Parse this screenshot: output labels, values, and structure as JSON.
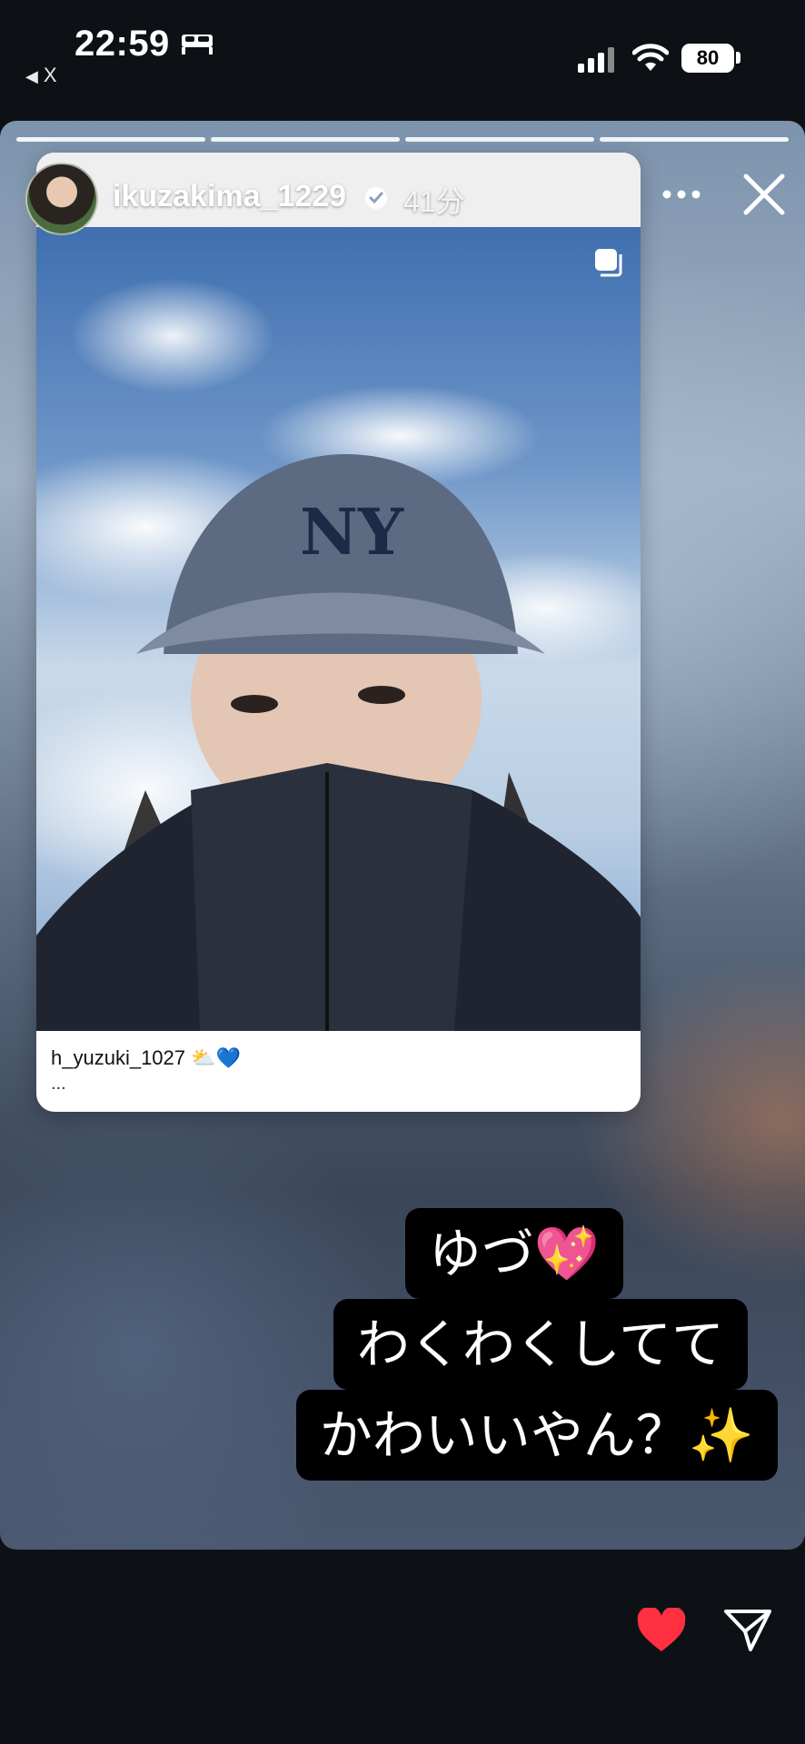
{
  "status_bar": {
    "time": "22:59",
    "back_app": "X",
    "battery": "80"
  },
  "story": {
    "progress_segments": 4,
    "username": "ikuzakima_1229",
    "timestamp": "41分",
    "shared_post": {
      "account": "h_yuzuki_1027",
      "caption": "h_yuzuki_1027 ⛅💙",
      "more": "..."
    },
    "sticker_lines": [
      "ゆづ💖",
      "わくわくしてて",
      "かわいいやん？✨"
    ]
  },
  "colors": {
    "background": "#0d1116",
    "like": "#ff3040"
  },
  "icons": [
    "bed-icon",
    "signal-icon",
    "wifi-icon",
    "verified-icon",
    "more-icon",
    "close-icon",
    "multi-photo-icon",
    "heart-icon",
    "send-icon"
  ]
}
